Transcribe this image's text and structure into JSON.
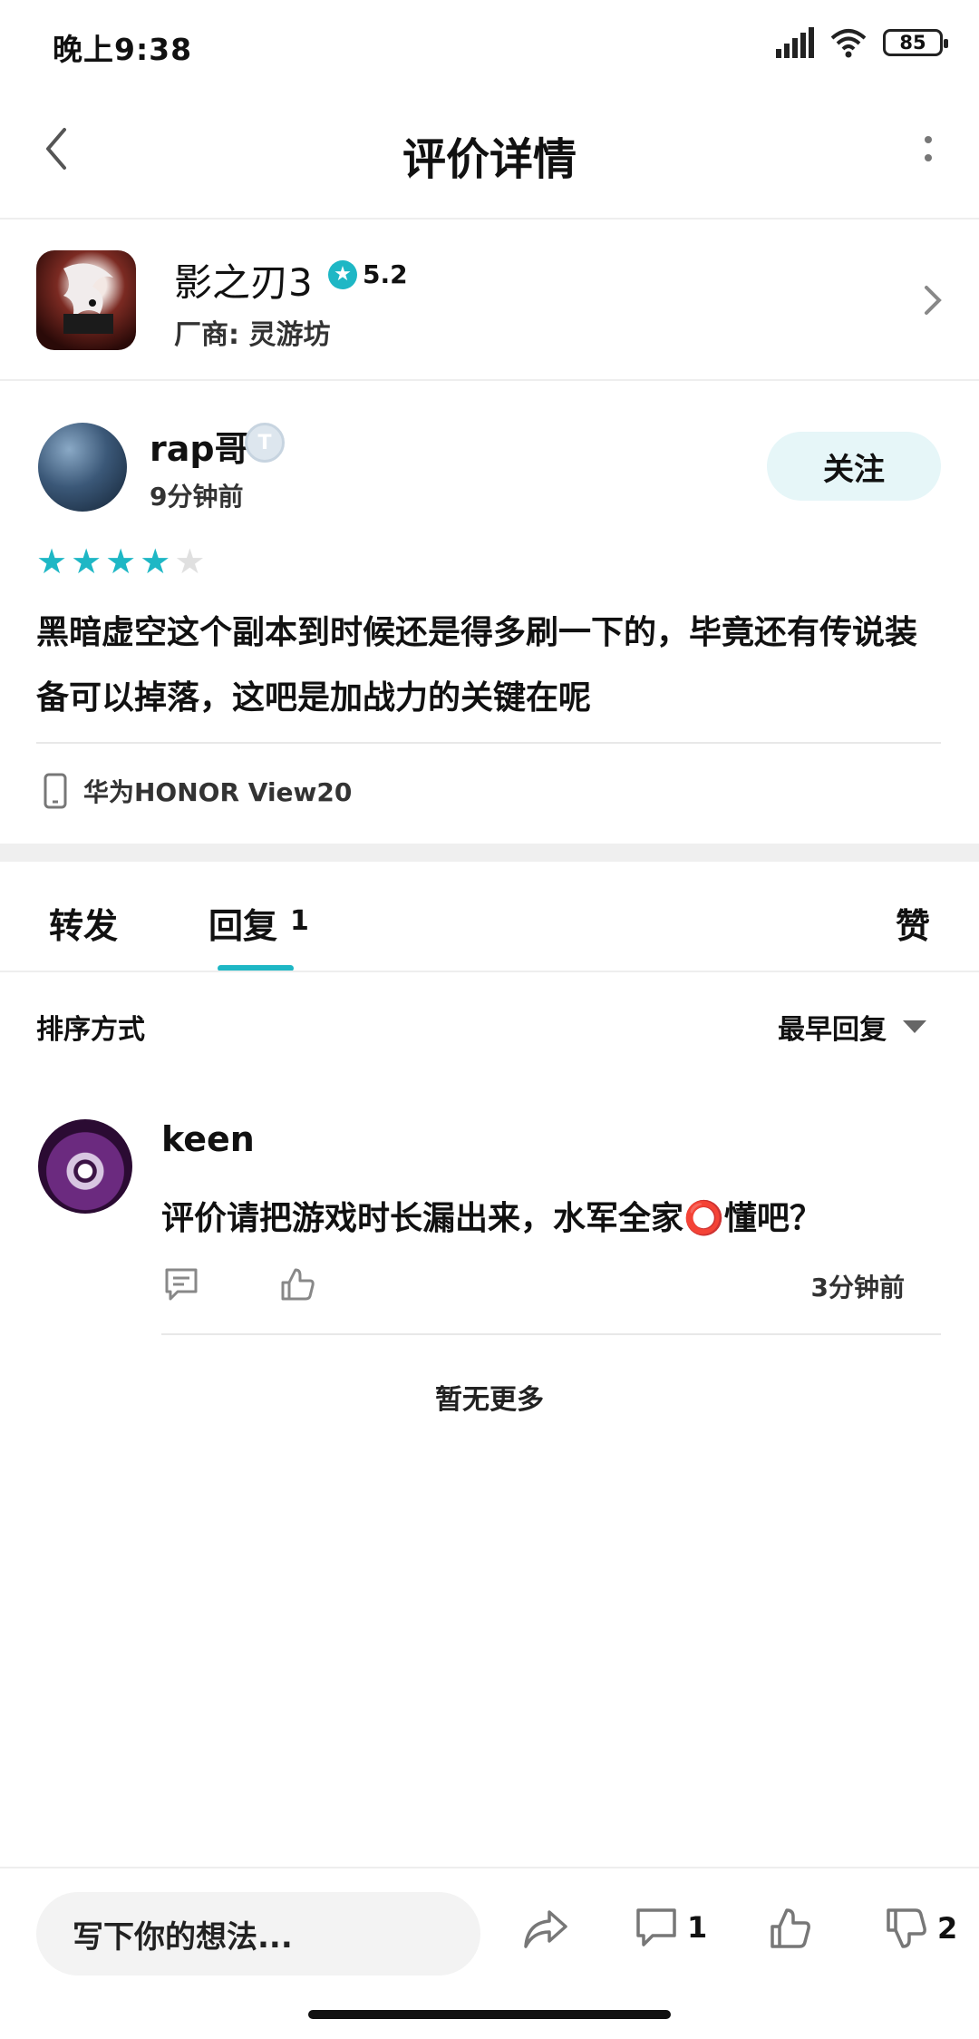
{
  "status_bar": {
    "time": "晚上9:38",
    "battery": "85"
  },
  "header": {
    "title": "评价详情"
  },
  "game": {
    "name": "影之刃3",
    "rating": "5.2",
    "vendor": "厂商: 灵游坊"
  },
  "review": {
    "username": "rap哥",
    "level": "T",
    "time": "9分钟前",
    "follow_label": "关注",
    "stars": 4,
    "max_stars": 5,
    "star_color": "#1eb7c5",
    "text": "黑暗虚空这个副本到时候还是得多刷一下的，毕竟还有传说装备可以掉落，这吧是加战力的关键在呢",
    "device": "华为HONOR View20"
  },
  "tabs": {
    "forward": "转发",
    "reply": "回复",
    "reply_count": "1",
    "like": "赞"
  },
  "sort": {
    "label": "排序方式",
    "value": "最早回复"
  },
  "replies": [
    {
      "name": "keen",
      "text": "评价请把游戏时长漏出来，水军全家⭕懂吧？",
      "time": "3分钟前"
    }
  ],
  "no_more": "暂无更多",
  "bottom_bar": {
    "placeholder": "写下你的想法...",
    "comment_count": "1",
    "dislike_count": "2"
  },
  "accent_color": "#1eb7c5"
}
